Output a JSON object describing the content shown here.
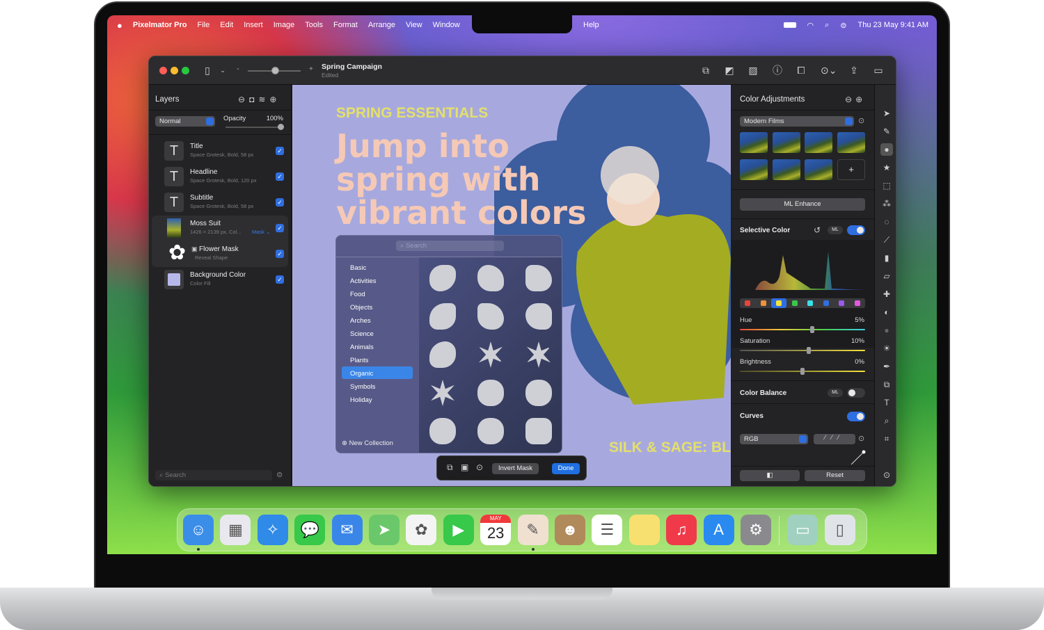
{
  "menubar": {
    "apple": "",
    "app": "Pixelmator Pro",
    "items": [
      "File",
      "Edit",
      "Insert",
      "Image",
      "Tools",
      "Format",
      "Arrange",
      "View",
      "Window"
    ],
    "help": "Help",
    "clock": "Thu 23 May  9:41 AM"
  },
  "toolbar": {
    "doc_title": "Spring Campaign",
    "doc_status": "Edited",
    "zoom_minus": "-",
    "zoom_plus": "+"
  },
  "layers_panel": {
    "title": "Layers",
    "blend_mode": "Normal",
    "opacity_label": "Opacity",
    "opacity_value": "100%",
    "opacity_fraction": 1.0,
    "layers": [
      {
        "name": "Title",
        "sub": "Space Grotesk, Bold, 58 px",
        "icon": "T"
      },
      {
        "name": "Headline",
        "sub": "Space Grotesk, Bold, 120 px",
        "icon": "T"
      },
      {
        "name": "Subtitle",
        "sub": "Space Grotesk, Bold, 58 px",
        "icon": "T"
      },
      {
        "name": "Moss Suit",
        "sub": "1426 × 2139 px, Col...",
        "badge": "Mask ⌄"
      },
      {
        "name": "Flower Mask",
        "sub": "Reveal Shape"
      },
      {
        "name": "Background Color",
        "sub": "Color Fill"
      }
    ],
    "search_placeholder": "Search"
  },
  "canvas": {
    "kicker": "SPRING ESSENTIALS",
    "headline": [
      "Jump into",
      "spring with",
      "vibrant colors"
    ],
    "footer": "SILK & SAGE: BL",
    "colors": {
      "bg": "#a7a9de",
      "flower": "#3c5d9e",
      "kicker": "#e4e06a",
      "headline": "#f5c9b6"
    }
  },
  "shape_picker": {
    "search_placeholder": "Search",
    "categories": [
      "Basic",
      "Activities",
      "Food",
      "Objects",
      "Arches",
      "Science",
      "Animals",
      "Plants",
      "Organic",
      "Symbols",
      "Holiday"
    ],
    "selected": "Organic",
    "new_collection": "New Collection"
  },
  "mask_bar": {
    "invert": "Invert Mask",
    "done": "Done"
  },
  "adjustments": {
    "title": "Color Adjustments",
    "preset": "Modern Films",
    "add": "+",
    "ml_enhance": "ML Enhance",
    "selective_color": {
      "title": "Selective Color",
      "ml": "ML",
      "enabled": true,
      "swatches": [
        "#e8453a",
        "#f0923a",
        "#f2e23a",
        "#3ac84a",
        "#3ae0e8",
        "#2f6ee0",
        "#9a5ae8",
        "#e05ae0"
      ],
      "selected_swatch": 2,
      "sliders": [
        {
          "label": "Hue",
          "value": "5%",
          "pos": 0.58
        },
        {
          "label": "Saturation",
          "value": "10%",
          "pos": 0.55
        },
        {
          "label": "Brightness",
          "value": "0%",
          "pos": 0.5
        }
      ]
    },
    "color_balance": {
      "title": "Color Balance",
      "ml": "ML",
      "enabled": false
    },
    "curves": {
      "title": "Curves",
      "enabled": true,
      "channel": "RGB"
    },
    "reset": "Reset"
  },
  "dock": {
    "calendar_month": "MAY",
    "calendar_day": "23",
    "apps": [
      {
        "name": "Finder",
        "color": "#3a8ee8"
      },
      {
        "name": "Launchpad",
        "color": "#e8e8ee"
      },
      {
        "name": "Safari",
        "color": "#2f8ae8"
      },
      {
        "name": "Messages",
        "color": "#38c84a"
      },
      {
        "name": "Mail",
        "color": "#3a86e8"
      },
      {
        "name": "Maps",
        "color": "#6ac86a"
      },
      {
        "name": "Photos",
        "color": "#f4f4f4"
      },
      {
        "name": "FaceTime",
        "color": "#38c84a"
      },
      {
        "name": "Calendar",
        "color": "#ffffff"
      },
      {
        "name": "Pixelmator Pro",
        "color": "#f0e0d0"
      },
      {
        "name": "Contacts",
        "color": "#b08a5a"
      },
      {
        "name": "Reminders",
        "color": "#ffffff"
      },
      {
        "name": "Notes",
        "color": "#f8e070"
      },
      {
        "name": "Music",
        "color": "#f03a4a"
      },
      {
        "name": "App Store",
        "color": "#2a8af0"
      },
      {
        "name": "System Settings",
        "color": "#8a8a8e"
      },
      {
        "name": "Downloads",
        "color": "#a0d0c0"
      },
      {
        "name": "Trash",
        "color": "#e0e4e8"
      }
    ]
  }
}
